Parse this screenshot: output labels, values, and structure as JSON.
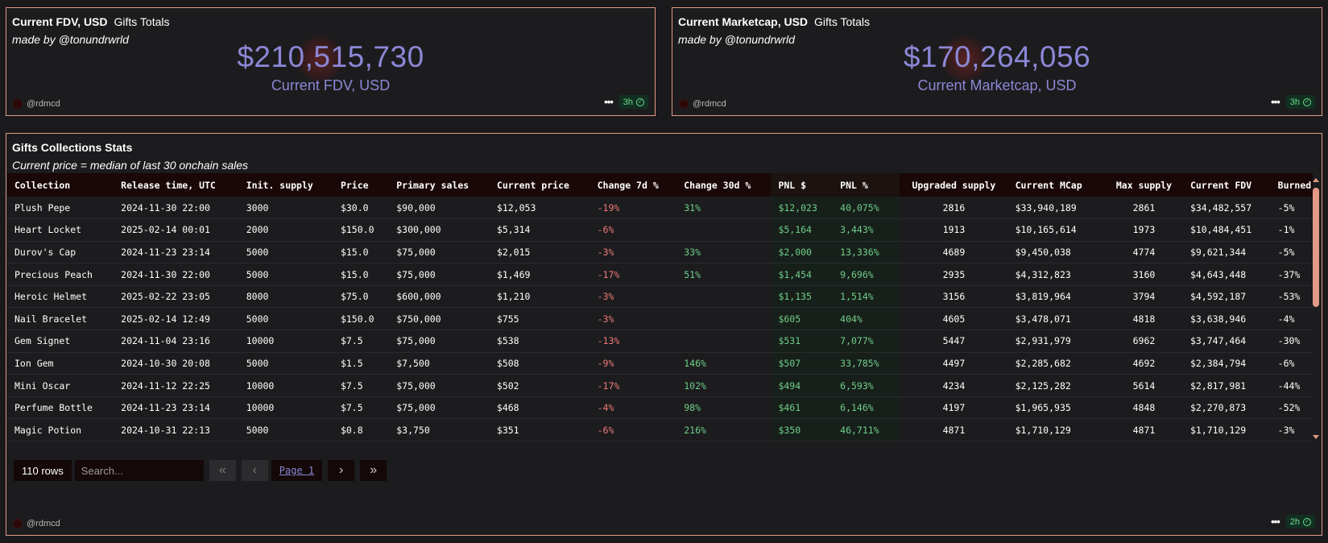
{
  "fdv_panel": {
    "title": "Current FDV, USD",
    "subtitle_tag": "Gifts Totals",
    "author": "made by @tonundrwrld",
    "value": "$210,515,730",
    "label": "Current FDV, USD",
    "user": "@rdmcd",
    "badge": "3h"
  },
  "mcap_panel": {
    "title": "Current Marketcap, USD",
    "subtitle_tag": "Gifts Totals",
    "author": "made by @tonundrwrld",
    "value": "$170,264,056",
    "label": "Current Marketcap, USD",
    "user": "@rdmcd",
    "badge": "3h"
  },
  "stats_panel": {
    "title": "Gifts Collections Stats",
    "subtitle": "Current price = median of last 30 onchain sales",
    "user": "@rdmcd",
    "badge": "2h",
    "columns": [
      "Collection",
      "Release time, UTC",
      "Init. supply",
      "Price",
      "Primary sales",
      "Current price",
      "Change 7d %",
      "Change 30d %",
      "PNL $",
      "PNL %",
      "Upgraded supply",
      "Current MCap",
      "Max supply",
      "Current FDV",
      "Burned"
    ],
    "rows": [
      [
        "Plush Pepe",
        "2024-11-30 22:00",
        "3000",
        "$30.0",
        "$90,000",
        "$12,053",
        "-19%",
        "31%",
        "$12,023",
        "40,075%",
        "2816",
        "$33,940,189",
        "2861",
        "$34,482,557",
        "-5%"
      ],
      [
        "Heart Locket",
        "2025-02-14 00:01",
        "2000",
        "$150.0",
        "$300,000",
        "$5,314",
        "-6%",
        "",
        "$5,164",
        "3,443%",
        "1913",
        "$10,165,614",
        "1973",
        "$10,484,451",
        "-1%"
      ],
      [
        "Durov's Cap",
        "2024-11-23 23:14",
        "5000",
        "$15.0",
        "$75,000",
        "$2,015",
        "-3%",
        "33%",
        "$2,000",
        "13,336%",
        "4689",
        "$9,450,038",
        "4774",
        "$9,621,344",
        "-5%"
      ],
      [
        "Precious Peach",
        "2024-11-30 22:00",
        "5000",
        "$15.0",
        "$75,000",
        "$1,469",
        "-17%",
        "51%",
        "$1,454",
        "9,696%",
        "2935",
        "$4,312,823",
        "3160",
        "$4,643,448",
        "-37%"
      ],
      [
        "Heroic Helmet",
        "2025-02-22 23:05",
        "8000",
        "$75.0",
        "$600,000",
        "$1,210",
        "-3%",
        "",
        "$1,135",
        "1,514%",
        "3156",
        "$3,819,964",
        "3794",
        "$4,592,187",
        "-53%"
      ],
      [
        "Nail Bracelet",
        "2025-02-14 12:49",
        "5000",
        "$150.0",
        "$750,000",
        "$755",
        "-3%",
        "",
        "$605",
        "404%",
        "4605",
        "$3,478,071",
        "4818",
        "$3,638,946",
        "-4%"
      ],
      [
        "Gem Signet",
        "2024-11-04 23:16",
        "10000",
        "$7.5",
        "$75,000",
        "$538",
        "-13%",
        "",
        "$531",
        "7,077%",
        "5447",
        "$2,931,979",
        "6962",
        "$3,747,464",
        "-30%"
      ],
      [
        "Ion Gem",
        "2024-10-30 20:08",
        "5000",
        "$1.5",
        "$7,500",
        "$508",
        "-9%",
        "146%",
        "$507",
        "33,785%",
        "4497",
        "$2,285,682",
        "4692",
        "$2,384,794",
        "-6%"
      ],
      [
        "Mini Oscar",
        "2024-11-12 22:25",
        "10000",
        "$7.5",
        "$75,000",
        "$502",
        "-17%",
        "102%",
        "$494",
        "6,593%",
        "4234",
        "$2,125,282",
        "5614",
        "$2,817,981",
        "-44%"
      ],
      [
        "Perfume Bottle",
        "2024-11-23 23:14",
        "10000",
        "$7.5",
        "$75,000",
        "$468",
        "-4%",
        "98%",
        "$461",
        "6,146%",
        "4197",
        "$1,965,935",
        "4848",
        "$2,270,873",
        "-52%"
      ],
      [
        "Magic Potion",
        "2024-10-31 22:13",
        "5000",
        "$0.8",
        "$3,750",
        "$351",
        "-6%",
        "216%",
        "$350",
        "46,711%",
        "4871",
        "$1,710,129",
        "4871",
        "$1,710,129",
        "-3%"
      ]
    ],
    "pager": {
      "rows_label": "110 rows",
      "search_placeholder": "Search...",
      "page_label": "Page 1"
    }
  }
}
